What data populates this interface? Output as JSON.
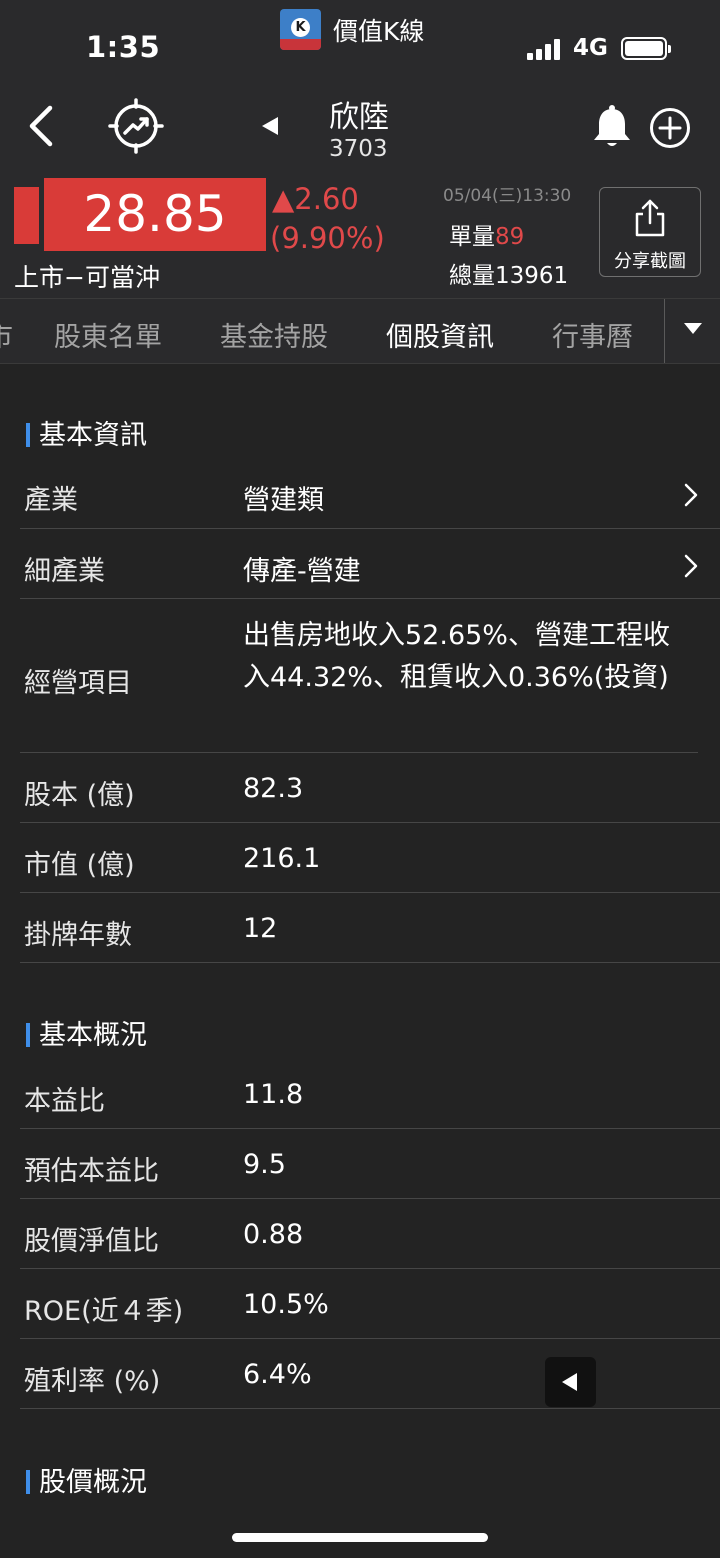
{
  "status_bar": {
    "time": "1:35",
    "app_name": "價值K線",
    "app_badge_letter": "K",
    "network": "4G"
  },
  "header": {
    "stock_name": "欣陸",
    "stock_code": "3703",
    "price": "28.85",
    "change": "▲2.60",
    "change_pct": "(9.90%)",
    "listing": "上市−可當沖",
    "datetime": "05/04(三)13:30",
    "single_vol_label": "單量",
    "single_vol": "89",
    "total_vol_label": "總量",
    "total_vol": "13961",
    "share_label": "分享截圖",
    "up_color": "#d93b38"
  },
  "tabs": [
    {
      "label": "市",
      "active": false
    },
    {
      "label": "股東名單",
      "active": false
    },
    {
      "label": "基金持股",
      "active": false
    },
    {
      "label": "個股資訊",
      "active": true
    },
    {
      "label": "行事曆",
      "active": false
    }
  ],
  "sections": {
    "basic_info": {
      "title": "基本資訊",
      "rows": [
        {
          "label": "產業",
          "value": "營建類"
        },
        {
          "label": "細產業",
          "value": "傳產-營建"
        },
        {
          "label": "經營項目",
          "value": "出售房地收入52.65%、營建工程收入44.32%、租賃收入0.36%(投資)"
        },
        {
          "label": "股本 (億)",
          "value": "82.3"
        },
        {
          "label": "市值 (億)",
          "value": "216.1"
        },
        {
          "label": "掛牌年數",
          "value": "12"
        }
      ]
    },
    "overview": {
      "title": "基本概況",
      "rows": [
        {
          "label": "本益比",
          "value": "11.8"
        },
        {
          "label": "預估本益比",
          "value": "9.5"
        },
        {
          "label": "股價淨值比",
          "value": "0.88"
        },
        {
          "label": "ROE(近４季)",
          "value": "10.5%"
        },
        {
          "label": "殖利率 (%)",
          "value": "6.4%"
        }
      ]
    },
    "price_overview": {
      "title": "股價概況"
    }
  },
  "icons": [
    "back-icon",
    "trend-chart-icon",
    "prev-stock-icon",
    "bell-icon",
    "add-icon",
    "share-icon",
    "chevron-right-icon",
    "dropdown-icon",
    "collapse-icon"
  ]
}
